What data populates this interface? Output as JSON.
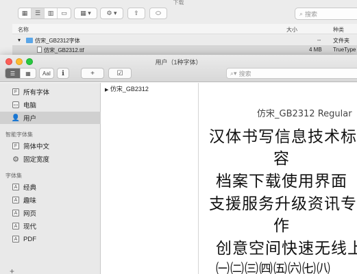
{
  "finder": {
    "title": "下载",
    "search_placeholder": "搜索",
    "columns": {
      "name": "名称",
      "size": "大小",
      "kind": "种类"
    },
    "rows": [
      {
        "name": "仿宋_GB2312字体",
        "size": "--",
        "kind": "文件夹"
      },
      {
        "name": "仿宋_GB2312.ttf",
        "size": "4 MB",
        "kind": "TrueType"
      }
    ]
  },
  "fontbook": {
    "title": "用户（1种字体）",
    "search_placeholder": "搜索",
    "toolbar": {
      "aa_label": "AaI",
      "info_label": "ℹ",
      "add_label": "+",
      "validate_label": "☑"
    },
    "sidebar": {
      "collections": [
        {
          "label": "所有字体",
          "icon": "font-collection-icon"
        },
        {
          "label": "电脑",
          "icon": "computer-icon"
        },
        {
          "label": "用户",
          "icon": "user-icon",
          "selected": true
        }
      ],
      "smart_section": "智能字体集",
      "smart": [
        {
          "label": "简体中文",
          "icon": "smart-collection-icon"
        },
        {
          "label": "固定宽度",
          "icon": "gear-icon"
        }
      ],
      "sets_section": "字体集",
      "sets": [
        {
          "label": "经典",
          "icon": "font-set-icon"
        },
        {
          "label": "趣味",
          "icon": "font-set-icon"
        },
        {
          "label": "网页",
          "icon": "font-set-icon"
        },
        {
          "label": "现代",
          "icon": "font-set-icon"
        },
        {
          "label": "PDF",
          "icon": "font-set-icon"
        }
      ],
      "add_label": "+"
    },
    "font_list": [
      "仿宋_GB2312"
    ],
    "preview": {
      "font_name": "仿宋_GB2312 Regular",
      "lines": [
        "汉体书写信息技术标",
        "容",
        "档案下载使用界面",
        "支援服务升级资讯专",
        "作",
        "创意空间快速无线上",
        "㈠㈡㈢㈣㈤㈥㈦㈧"
      ]
    }
  }
}
